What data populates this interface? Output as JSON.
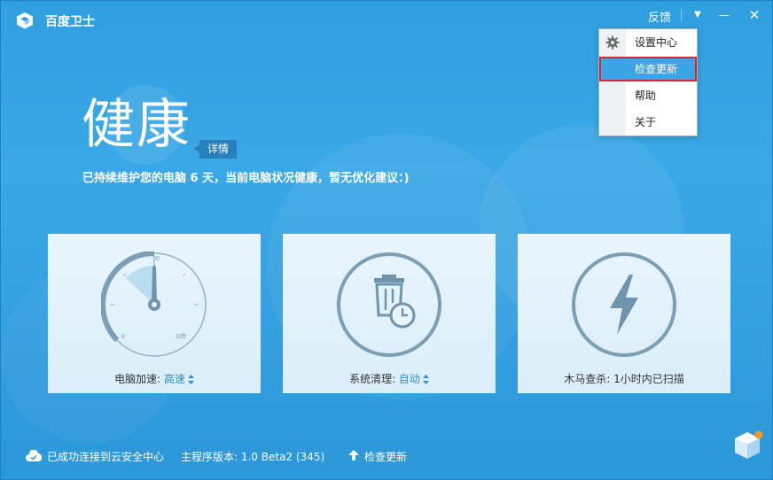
{
  "app": {
    "title": "百度卫士"
  },
  "titlebar": {
    "feedback": "反馈",
    "menu_glyph": "▼",
    "min_glyph": "—",
    "close_glyph": "✕"
  },
  "menu": {
    "items": [
      {
        "label": "设置中心",
        "icon": "gear-icon"
      },
      {
        "label": "检查更新",
        "highlighted": true
      },
      {
        "label": "帮助"
      },
      {
        "label": "关于"
      }
    ]
  },
  "hero": {
    "status": "健康",
    "detail": "详情",
    "summary": "已持续维护您的电脑 6 天，当前电脑状况健康，暂无优化建议：)"
  },
  "cards": [
    {
      "name": "电脑加速: ",
      "value": "高速",
      "icon": "speedometer-icon",
      "gauge": {
        "labels": [
          "0",
          "50",
          "100"
        ]
      }
    },
    {
      "name": "系统清理: ",
      "value": "自动",
      "icon": "trash-clock-icon"
    },
    {
      "name": "木马查杀: 1小时内已扫描",
      "value": "",
      "icon": "lightning-icon"
    }
  ],
  "footer": {
    "connection": "已成功连接到云安全中心",
    "version": "主程序版本: 1.0 Beta2 (345)",
    "update": "检查更新"
  },
  "colors": {
    "background": "#2f9fe0",
    "accent": "#2a8fd5",
    "menu_highlight": "#3ba6e3",
    "highlight_border": "#d9242b",
    "card_bg": "#e9f5fc"
  }
}
